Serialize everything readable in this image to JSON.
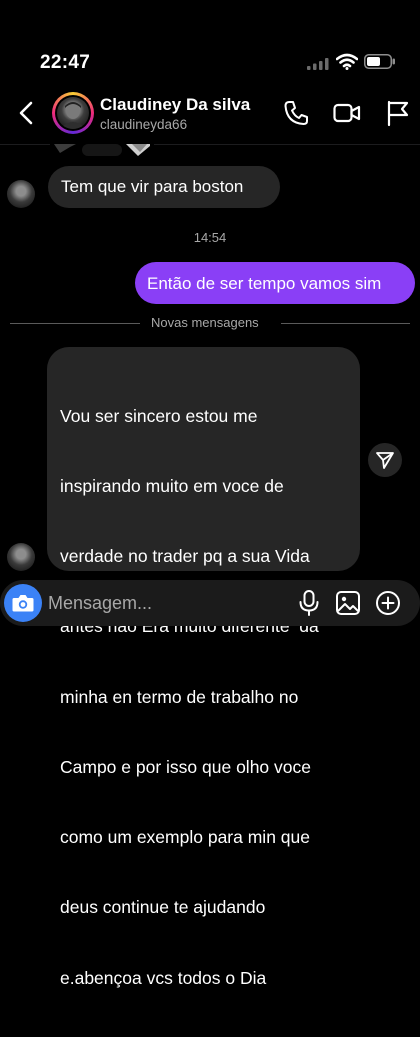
{
  "status_bar": {
    "time": "22:47",
    "icons": [
      "cellular-signal-icon",
      "wifi-icon",
      "battery-icon"
    ]
  },
  "header": {
    "contact_name": "Claudiney Da silva",
    "username": "claudineyda66",
    "icons": [
      "back-chevron-icon",
      "phone-icon",
      "video-camera-icon",
      "flag-icon"
    ]
  },
  "messages": [
    {
      "direction": "incoming",
      "text": "Tem que vir para boston"
    },
    {
      "direction": "system",
      "text": "14:54"
    },
    {
      "direction": "outgoing",
      "text": "Então de ser tempo vamos sim"
    },
    {
      "direction": "divider",
      "text": "Novas mensagens"
    },
    {
      "direction": "incoming",
      "lines": [
        "Vou ser sincero estou me",
        "inspirando muito em voce de",
        "verdade no trader pq a sua Vida",
        "antes nao Era muito diferente  da",
        "minha en termo de trabalho no",
        "Campo e por isso que olho voce",
        "como um exemplo para min que",
        "deus continue te ajudando",
        "e.abençoa vcs todos o Dia"
      ]
    }
  ],
  "composer": {
    "placeholder": "Mensagem...",
    "value": "",
    "icons": [
      "camera-icon",
      "microphone-icon",
      "gallery-icon",
      "add-circle-icon",
      "share-send-icon"
    ]
  },
  "colors": {
    "background": "#000000",
    "incoming_bubble": "#262626",
    "outgoing_bubble": "#8a3ff6",
    "camera_button": "#3b82f6",
    "secondary_text": "#a8a8a8"
  }
}
